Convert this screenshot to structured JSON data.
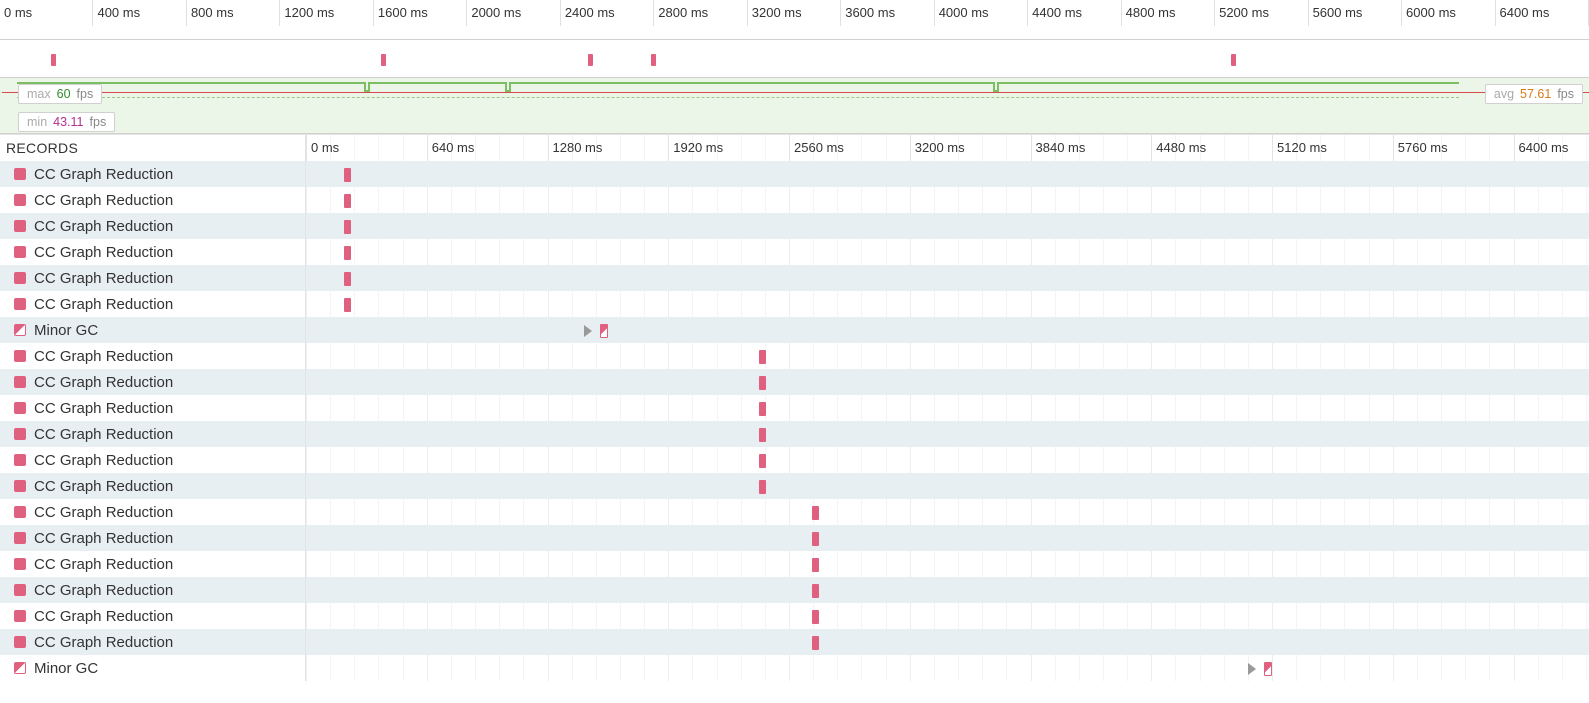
{
  "overview": {
    "ticks": [
      "0 ms",
      "400 ms",
      "800 ms",
      "1200 ms",
      "1600 ms",
      "2000 ms",
      "2400 ms",
      "2800 ms",
      "3200 ms",
      "3600 ms",
      "4000 ms",
      "4400 ms",
      "4800 ms",
      "5200 ms",
      "5600 ms",
      "6000 ms",
      "6400 ms"
    ],
    "markers_pct": [
      3.2,
      24.0,
      37.0,
      41.0,
      77.5
    ]
  },
  "fps": {
    "max": {
      "label": "max",
      "value": "60",
      "unit": "fps"
    },
    "min": {
      "label": "min",
      "value": "43.11",
      "unit": "fps"
    },
    "avg": {
      "label": "avg",
      "value": "57.61",
      "unit": "fps"
    },
    "notches_pct": [
      22.9,
      31.8,
      62.5
    ]
  },
  "lanes": {
    "max_ms": 6800,
    "ticks": [
      {
        "ms": 0,
        "label": "0 ms"
      },
      {
        "ms": 640,
        "label": "640 ms"
      },
      {
        "ms": 1280,
        "label": "1280 ms"
      },
      {
        "ms": 1920,
        "label": "1920 ms"
      },
      {
        "ms": 2560,
        "label": "2560 ms"
      },
      {
        "ms": 3200,
        "label": "3200 ms"
      },
      {
        "ms": 3840,
        "label": "3840 ms"
      },
      {
        "ms": 4480,
        "label": "4480 ms"
      },
      {
        "ms": 5120,
        "label": "5120 ms"
      },
      {
        "ms": 5760,
        "label": "5760 ms"
      },
      {
        "ms": 6400,
        "label": "6400 ms"
      }
    ],
    "minor_step": 128
  },
  "records_header": "RECORDS",
  "rows": [
    {
      "type": "gc",
      "label": "CC Graph Reduction",
      "at_ms": 200
    },
    {
      "type": "gc",
      "label": "CC Graph Reduction",
      "at_ms": 200
    },
    {
      "type": "gc",
      "label": "CC Graph Reduction",
      "at_ms": 200
    },
    {
      "type": "gc",
      "label": "CC Graph Reduction",
      "at_ms": 200
    },
    {
      "type": "gc",
      "label": "CC Graph Reduction",
      "at_ms": 200
    },
    {
      "type": "gc",
      "label": "CC Graph Reduction",
      "at_ms": 200
    },
    {
      "type": "minor",
      "label": "Minor GC",
      "at_ms": 1560,
      "tri": true
    },
    {
      "type": "gc",
      "label": "CC Graph Reduction",
      "at_ms": 2400
    },
    {
      "type": "gc",
      "label": "CC Graph Reduction",
      "at_ms": 2400
    },
    {
      "type": "gc",
      "label": "CC Graph Reduction",
      "at_ms": 2400
    },
    {
      "type": "gc",
      "label": "CC Graph Reduction",
      "at_ms": 2400
    },
    {
      "type": "gc",
      "label": "CC Graph Reduction",
      "at_ms": 2400
    },
    {
      "type": "gc",
      "label": "CC Graph Reduction",
      "at_ms": 2400
    },
    {
      "type": "gc",
      "label": "CC Graph Reduction",
      "at_ms": 2680
    },
    {
      "type": "gc",
      "label": "CC Graph Reduction",
      "at_ms": 2680
    },
    {
      "type": "gc",
      "label": "CC Graph Reduction",
      "at_ms": 2680
    },
    {
      "type": "gc",
      "label": "CC Graph Reduction",
      "at_ms": 2680
    },
    {
      "type": "gc",
      "label": "CC Graph Reduction",
      "at_ms": 2680
    },
    {
      "type": "gc",
      "label": "CC Graph Reduction",
      "at_ms": 2680
    },
    {
      "type": "minor",
      "label": "Minor GC",
      "at_ms": 5080,
      "tri": true
    }
  ]
}
